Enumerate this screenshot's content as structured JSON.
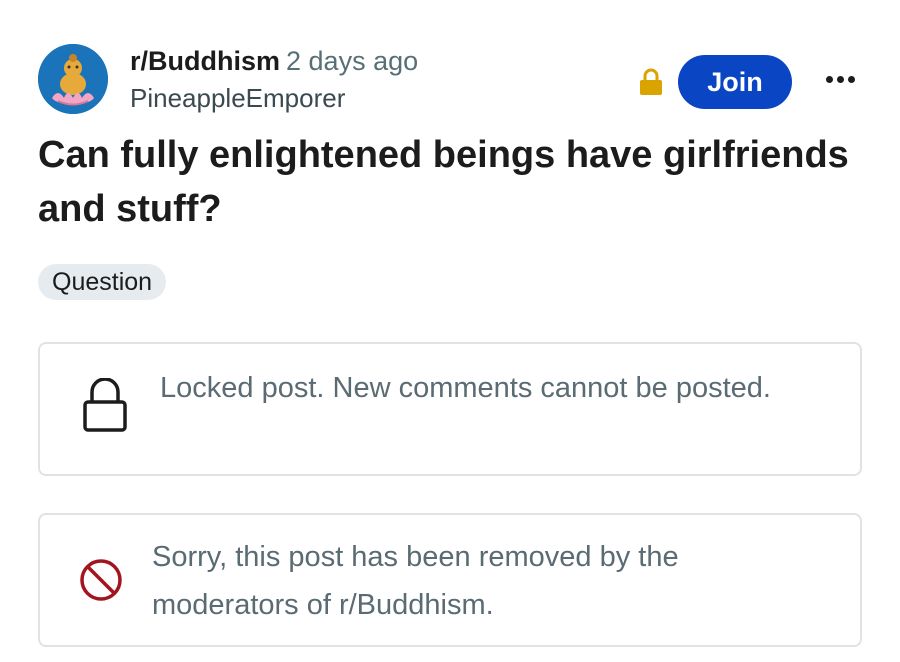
{
  "post": {
    "subreddit": "r/Buddhism",
    "time": "2 days ago",
    "author": "PineappleEmporer",
    "title": "Can fully enlightened beings have girlfriends and stuff?",
    "flair": "Question"
  },
  "actions": {
    "join_label": "Join",
    "more_icon": "ellipsis-icon",
    "lock_icon": "lock-icon"
  },
  "notices": {
    "locked": "Locked post. New comments cannot be posted.",
    "removed": "Sorry, this post has been removed by the moderators of r/Buddhism."
  },
  "colors": {
    "join": "#0a45c4",
    "lock_accent": "#d9a300",
    "removed_icon": "#a3151e",
    "muted_text": "#5a6b73"
  }
}
